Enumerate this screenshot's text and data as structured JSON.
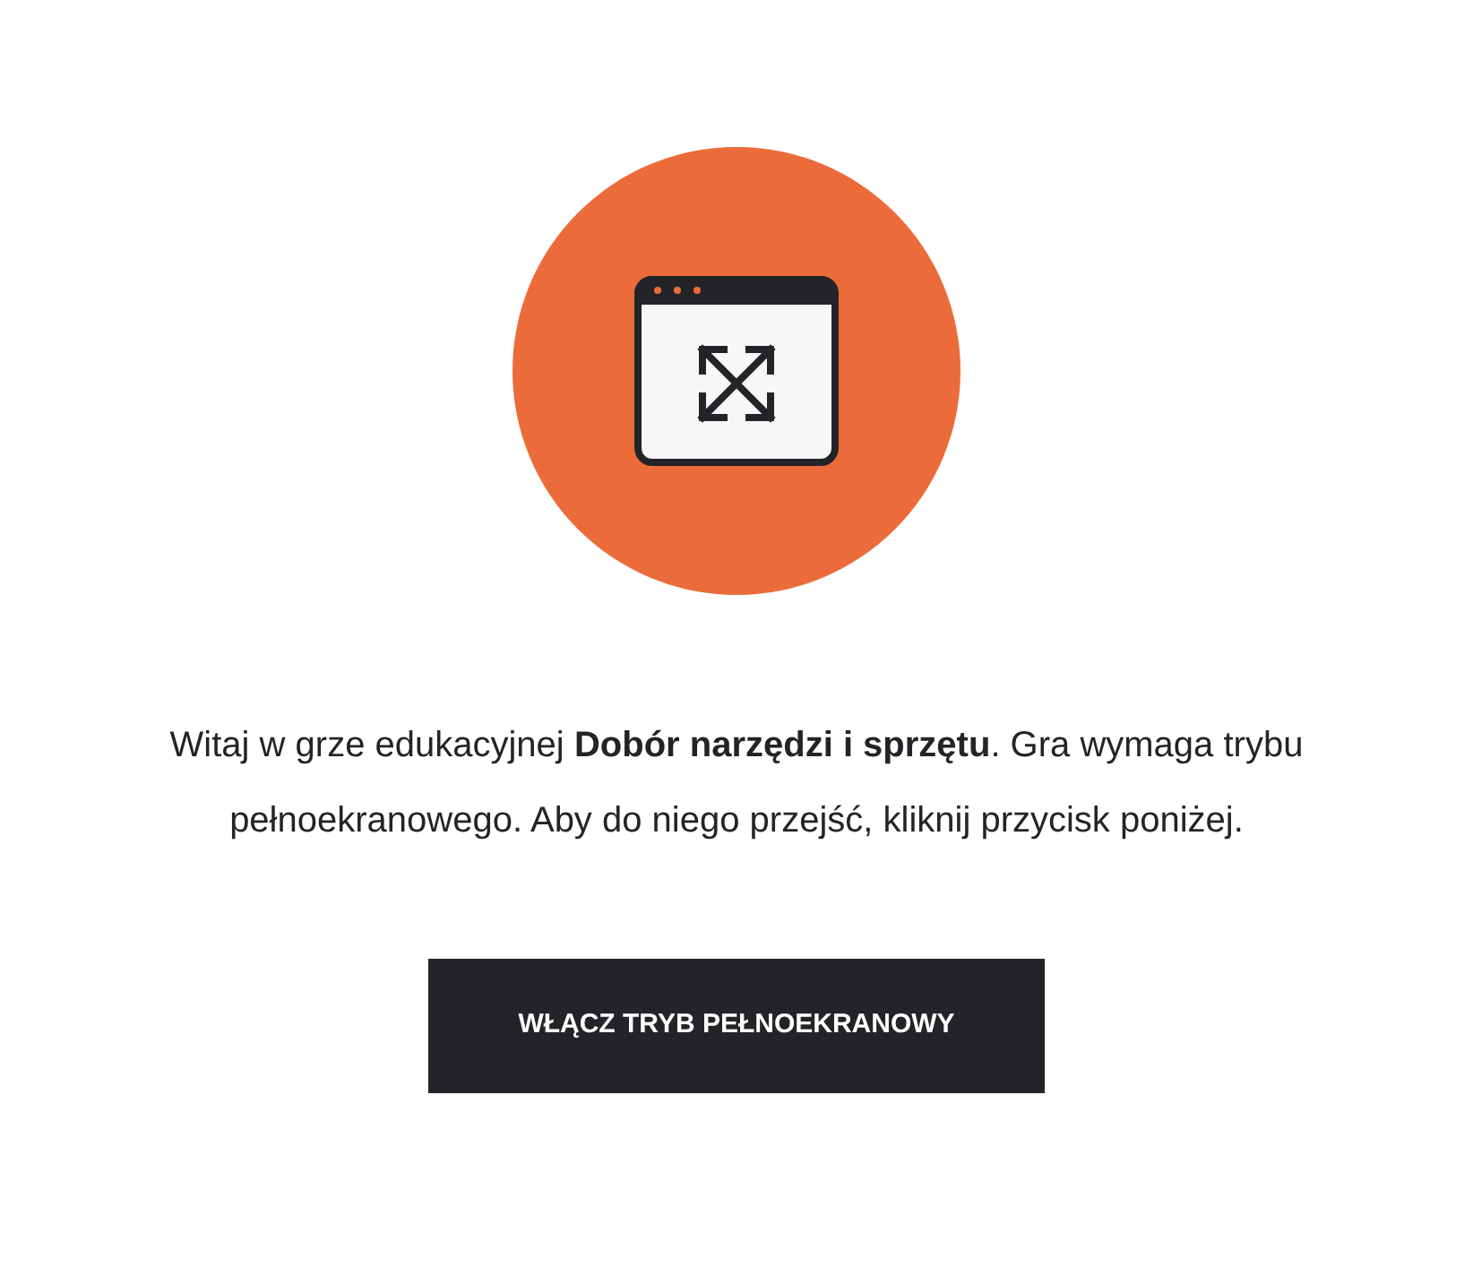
{
  "intro": {
    "text": "Witaj w grze edukacyjnej **Dobór narzędzi i sprzętu**. Gra wymaga trybu pełnoekranowego. Aby do niego przejść, kliknij przycisk poniżej."
  },
  "button": {
    "label": "WŁĄCZ TRYB PEŁNOEKRANOWY"
  }
}
